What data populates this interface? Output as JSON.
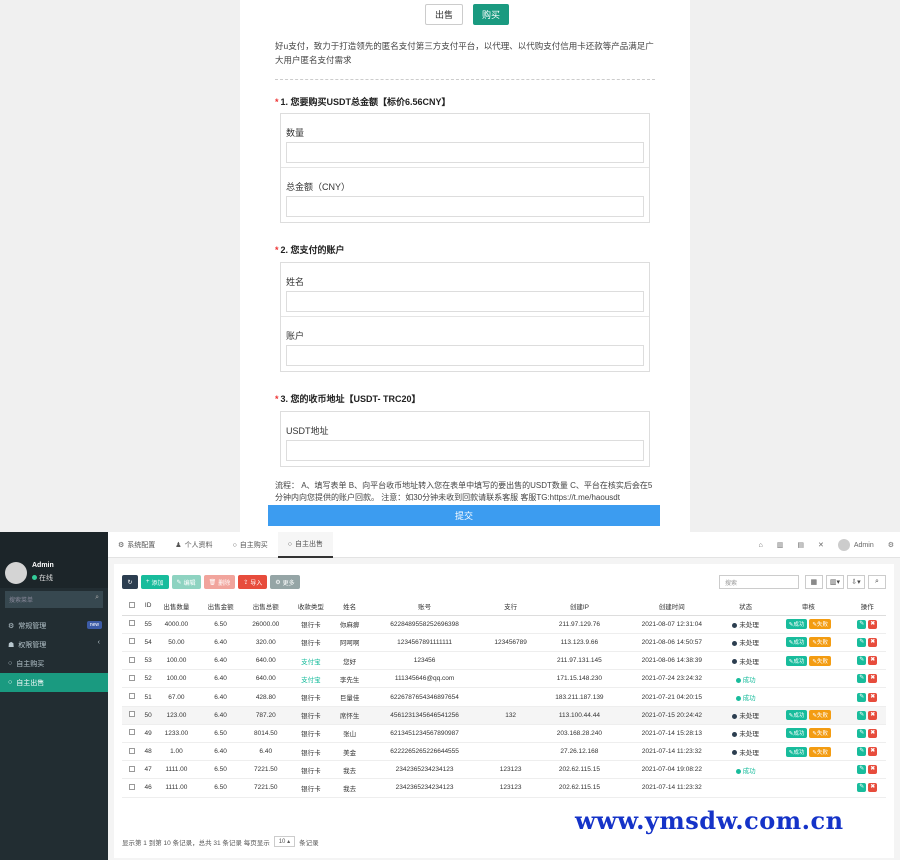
{
  "form": {
    "sell_label": "出售",
    "buy_label": "购买",
    "intro": "好u支付，致力于打造领先的匿名支付第三方支付平台，以代理、以代购支付信用卡还款等产品满足广大用户匿名支付需求",
    "q1": {
      "title": "1. 您要购买USDT总金额【标价6.56CNY】",
      "f1": "数量",
      "f2": "总金额（CNY）"
    },
    "q2": {
      "title": "2. 您支付的账户",
      "f1": "姓名",
      "f2": "账户"
    },
    "q3": {
      "title": "3. 您的收币地址【USDT- TRC20】",
      "f1": "USDT地址"
    },
    "process": "流程： A、填写表单 B、向平台收币地址转入您在表单中填写的要出售的USDT数量 C、平台在核实后会在5分钟内向您提供的账户回款。 注意：如30分钟未收到回款请联系客服 客服TG:https://t.me/haousdt",
    "submit_label": "提交"
  },
  "admin": {
    "tabs": [
      "系统配置",
      "个人资料",
      "自主购买",
      "自主出售"
    ],
    "topbar_user": "Admin",
    "sidebar": {
      "user": "Admin",
      "status": "在线",
      "search_placeholder": "搜索菜单",
      "items": [
        "常规管理",
        "权限管理",
        "自主购买",
        "自主出售"
      ],
      "badge": "new"
    },
    "toolbar": {
      "add": "添加",
      "edit": "编辑",
      "delete": "删除",
      "import": "导入",
      "more": "更多"
    },
    "search_placeholder": "搜索",
    "columns": [
      "ID",
      "出售数量",
      "出售金额",
      "出售总额",
      "收款类型",
      "姓名",
      "账号",
      "支行",
      "创建IP",
      "创建时间",
      "状态",
      "审核",
      "操作"
    ],
    "rows": [
      {
        "id": "55",
        "qty": "4000.00",
        "price": "6.50",
        "total": "26000.00",
        "type": "银行卡",
        "name": "你麻痹",
        "acct": "6228489558252696398",
        "branch": "",
        "ip": "211.97.129.76",
        "time": "2021-08-07 12:31:04",
        "status": "未处理",
        "audit": true
      },
      {
        "id": "54",
        "qty": "50.00",
        "price": "6.40",
        "total": "320.00",
        "type": "银行卡",
        "name": "阿呵啊",
        "acct": "1234567891111111",
        "branch": "123456789",
        "ip": "113.123.9.66",
        "time": "2021-08-06 14:50:57",
        "status": "未处理",
        "audit": true
      },
      {
        "id": "53",
        "qty": "100.00",
        "price": "6.40",
        "total": "640.00",
        "type": "支付宝",
        "name": "您好",
        "acct": "123456",
        "branch": "",
        "ip": "211.97.131.145",
        "time": "2021-08-06 14:38:39",
        "status": "未处理",
        "audit": true
      },
      {
        "id": "52",
        "qty": "100.00",
        "price": "6.40",
        "total": "640.00",
        "type": "支付宝",
        "name": "李先生",
        "acct": "111345646@qq.com",
        "branch": "",
        "ip": "171.15.148.230",
        "time": "2021-07-24 23:24:32",
        "status": "成功",
        "audit": false
      },
      {
        "id": "51",
        "qty": "67.00",
        "price": "6.40",
        "total": "428.80",
        "type": "银行卡",
        "name": "巨量佳",
        "acct": "6226787654346897654",
        "branch": "",
        "ip": "183.211.187.139",
        "time": "2021-07-21 04:20:15",
        "status": "成功",
        "audit": false
      },
      {
        "id": "50",
        "qty": "123.00",
        "price": "6.40",
        "total": "787.20",
        "type": "银行卡",
        "name": "席怀生",
        "acct": "4561231345646541256",
        "branch": "132",
        "ip": "113.100.44.44",
        "time": "2021-07-15 20:24:42",
        "status": "未处理",
        "audit": true
      },
      {
        "id": "49",
        "qty": "1233.00",
        "price": "6.50",
        "total": "8014.50",
        "type": "银行卡",
        "name": "张山",
        "acct": "6213451234567890987",
        "branch": "",
        "ip": "203.168.28.240",
        "time": "2021-07-14 15:28:13",
        "status": "未处理",
        "audit": true
      },
      {
        "id": "48",
        "qty": "1.00",
        "price": "6.40",
        "total": "6.40",
        "type": "银行卡",
        "name": "美金",
        "acct": "6222265265226644555",
        "branch": "",
        "ip": "27.26.12.168",
        "time": "2021-07-14 11:23:32",
        "status": "未处理",
        "audit": true
      },
      {
        "id": "47",
        "qty": "1111.00",
        "price": "6.50",
        "total": "7221.50",
        "type": "银行卡",
        "name": "我去",
        "acct": "2342365234234123",
        "branch": "123123",
        "ip": "202.62.115.15",
        "time": "2021-07-04 19:08:22",
        "status": "成功",
        "audit": false
      },
      {
        "id": "46",
        "qty": "1111.00",
        "price": "6.50",
        "total": "7221.50",
        "type": "银行卡",
        "name": "我去",
        "acct": "2342365234234123",
        "branch": "123123",
        "ip": "202.62.115.15",
        "time": "2021-07-14 11:23:32",
        "status": "",
        "audit": false
      }
    ],
    "audit_ok": "成功",
    "audit_fail": "失败",
    "footer_text": "显示第 1 到第 10 条记录，总共 31 条记录 每页显示",
    "page_size": "10",
    "footer_suffix": "条记录"
  },
  "watermark": "www.ymsdw.com.cn"
}
